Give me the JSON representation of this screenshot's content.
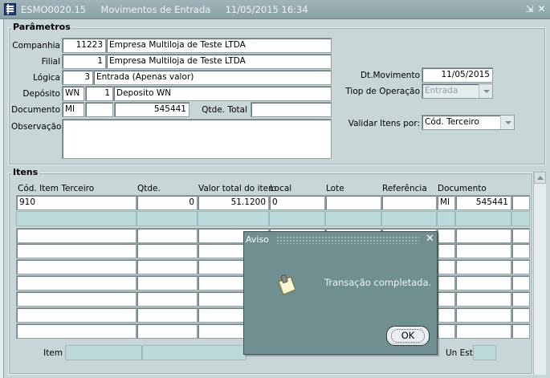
{
  "window": {
    "form_code": "ESMO0020.15",
    "form_title": "Movimentos de Entrada",
    "date_time": "11/05/2015 16:34"
  },
  "params": {
    "section_title": "Parâmetros",
    "companhia": {
      "label": "Companhia",
      "code": "11223",
      "name": "Empresa Multiloja de Teste LTDA"
    },
    "filial": {
      "label": "Filial",
      "code": "1",
      "name": "Empresa Multiloja de Teste LTDA"
    },
    "logica": {
      "label": "Lógica",
      "code": "3",
      "name": "Entrada (Apenas valor)"
    },
    "deposito": {
      "label": "Depósito",
      "prefix": "WN",
      "code": "1",
      "name": "Deposito WN"
    },
    "documento": {
      "label": "Documento",
      "prefix": "MI",
      "extra": "",
      "number": "545441"
    },
    "qtde_total": {
      "label": "Qtde. Total",
      "value": ""
    },
    "observacao": {
      "label": "Observação",
      "value": ""
    },
    "dt_movimento": {
      "label": "Dt.Movimento",
      "value": "11/05/2015"
    },
    "tiop_operacao": {
      "label": "Tiop de Operação",
      "value": "Entrada"
    },
    "validar_itens": {
      "label": "Validar Itens por:",
      "value": "Cód. Terceiro"
    }
  },
  "itens": {
    "section_title": "Itens",
    "headers": {
      "cod_item": "Cód. Item Terceiro",
      "qtde": "Qtde.",
      "valor_total": "Valor total do item",
      "local": "Local",
      "lote": "Lote",
      "referencia": "Referência",
      "documento": "Documento"
    },
    "rows": [
      {
        "cod_item": "910",
        "qtde": "0",
        "valor_total": "51.1200",
        "local": "0",
        "lote": "",
        "referencia": "",
        "doc_prefix": "MI",
        "doc_number": "545441"
      }
    ],
    "footer": {
      "item_label": "Item",
      "un_est_label": "Un Est"
    }
  },
  "dialog": {
    "title": "Aviso",
    "message": "Transação completada.",
    "ok_label": "OK"
  }
}
